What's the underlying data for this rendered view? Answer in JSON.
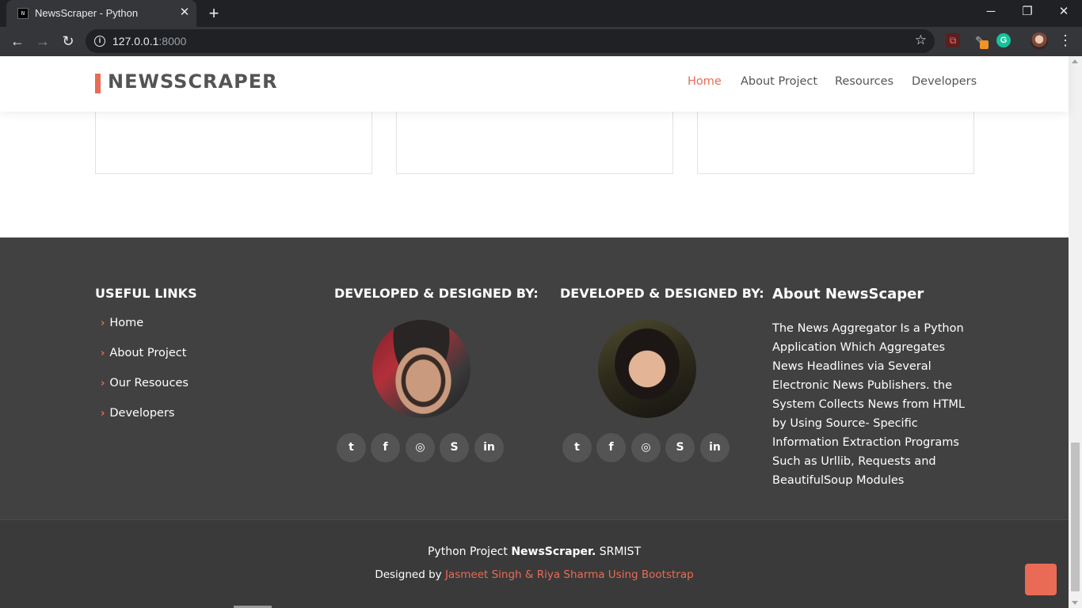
{
  "browser": {
    "tab_title": "NewsScraper - Python",
    "tab_favicon": "N",
    "close_glyph": "✕",
    "newtab_glyph": "+",
    "url_host": "127.0.0.1",
    "url_port": ":8000",
    "icons": {
      "back": "back-arrow-icon",
      "forward": "forward-arrow-icon",
      "reload": "reload-icon",
      "info": "info-icon",
      "star": "bookmark-star-icon",
      "menu": "kebab-menu-icon"
    }
  },
  "header": {
    "logo": "NEWSSCRAPER",
    "nav": [
      {
        "label": "Home",
        "active": true
      },
      {
        "label": "About Project",
        "active": false
      },
      {
        "label": "Resources",
        "active": false
      },
      {
        "label": "Developers",
        "active": false
      }
    ]
  },
  "footer": {
    "useful_links": {
      "title": "USEFUL LINKS",
      "items": [
        "Home",
        "About Project",
        "Our Resouces",
        "Developers"
      ]
    },
    "developer_1": {
      "title": "DEVELOPED & DESIGNED BY:",
      "social": [
        "twitter",
        "facebook",
        "instagram",
        "skype",
        "linkedin"
      ]
    },
    "developer_2": {
      "title": "DEVELOPED & DESIGNED BY:",
      "social": [
        "twitter",
        "facebook",
        "instagram",
        "skype",
        "linkedin"
      ]
    },
    "about": {
      "title": "About NewsScaper",
      "text": "The News Aggregator Is a Python Application Which Aggregates News Headlines via Several Electronic News Publishers. the System Collects News from HTML by Using Source- Specific Information Extraction Programs Such as Urllib, Requests and BeautifulSoup Modules"
    },
    "credits": {
      "line1_prefix": "Python Project ",
      "line1_bold": "NewsScraper.",
      "line1_suffix": " SRMIST",
      "line2_prefix": "Designed by ",
      "line2_accent": "Jasmeet Singh & Riya Sharma Using Bootstrap"
    }
  },
  "colors": {
    "accent": "#e96b56",
    "footer_bg": "#414141",
    "footer_bottom_bg": "#3a3a3a",
    "social_bg": "#545454"
  }
}
